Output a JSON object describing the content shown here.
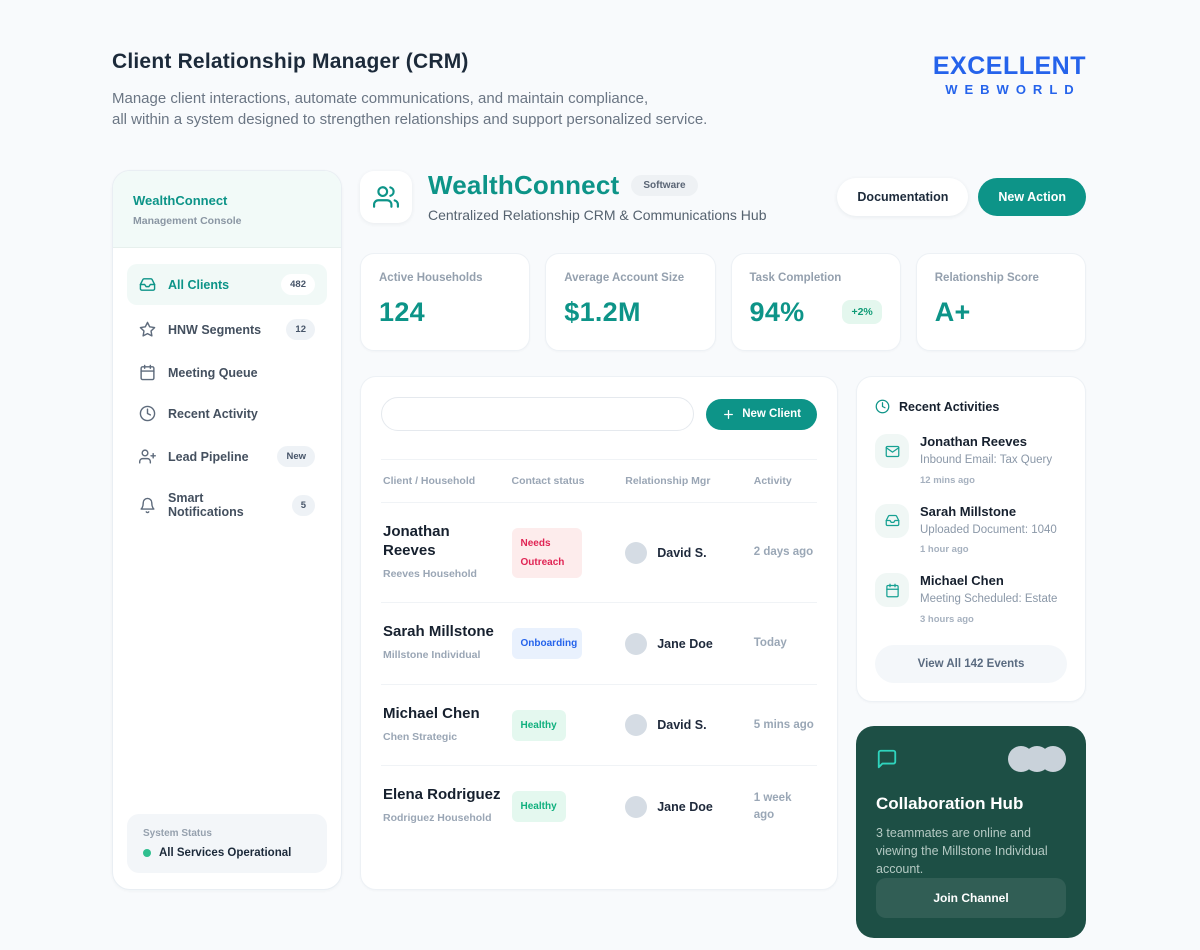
{
  "page": {
    "title": "Client Relationship Manager (CRM)",
    "subtitle_line1": "Manage client interactions, automate communications, and maintain compliance,",
    "subtitle_line2": "all within a system designed to strengthen relationships and support personalized service.",
    "logo_line1": "EXCELLENT",
    "logo_line2": "WEBWORLD"
  },
  "sidebar": {
    "brand": "WealthConnect",
    "brand_sub": "Management Console",
    "items": [
      {
        "label": "All Clients",
        "badge": "482",
        "icon": "inbox-icon"
      },
      {
        "label": "HNW Segments",
        "badge": "12",
        "icon": "star-icon"
      },
      {
        "label": "Meeting Queue",
        "badge": "",
        "icon": "calendar-icon"
      },
      {
        "label": "Recent Activity",
        "badge": "",
        "icon": "clock-icon"
      },
      {
        "label": "Lead Pipeline",
        "badge": "New",
        "icon": "user-plus-icon"
      },
      {
        "label": "Smart Notifications",
        "badge": "5",
        "icon": "bell-icon"
      }
    ],
    "system_status_label": "System Status",
    "system_status_value": "All Services Operational"
  },
  "header": {
    "app_name": "WealthConnect",
    "app_badge": "Software",
    "subtitle": "Centralized Relationship CRM & Communications Hub",
    "documentation_label": "Documentation",
    "new_action_label": "New Action"
  },
  "stats": [
    {
      "label": "Active Households",
      "value": "124",
      "delta": ""
    },
    {
      "label": "Average Account Size",
      "value": "$1.2M",
      "delta": ""
    },
    {
      "label": "Task Completion",
      "value": "94%",
      "delta": "+2%"
    },
    {
      "label": "Relationship Score",
      "value": "A+",
      "delta": ""
    }
  ],
  "clients": {
    "search_placeholder": "",
    "new_client_label": "New Client",
    "columns": {
      "c0": "Client / Household",
      "c1": "Contact status",
      "c2": "Relationship Mgr",
      "c3": "Activity"
    },
    "rows": [
      {
        "name": "Jonathan Reeves",
        "household": "Reeves Household",
        "status": "Needs Outreach",
        "status_type": "danger",
        "manager": "David S.",
        "activity": "2 days ago"
      },
      {
        "name": "Sarah Millstone",
        "household": "Millstone Individual",
        "status": "Onboarding",
        "status_type": "info",
        "manager": "Jane Doe",
        "activity": "Today"
      },
      {
        "name": "Michael Chen",
        "household": "Chen Strategic",
        "status": "Healthy",
        "status_type": "success",
        "manager": "David S.",
        "activity": "5 mins ago"
      },
      {
        "name": "Elena Rodriguez",
        "household": "Rodriguez Household",
        "status": "Healthy",
        "status_type": "success",
        "manager": "Jane Doe",
        "activity": "1 week ago"
      }
    ]
  },
  "activities": {
    "title": "Recent Activities",
    "items": [
      {
        "name": "Jonathan Reeves",
        "detail": "Inbound Email: Tax Query",
        "time": "12 mins ago",
        "icon": "mail-icon"
      },
      {
        "name": "Sarah Millstone",
        "detail": "Uploaded Document: 1040",
        "time": "1 hour ago",
        "icon": "inbox-icon"
      },
      {
        "name": "Michael Chen",
        "detail": "Meeting Scheduled: Estate",
        "time": "3 hours ago",
        "icon": "calendar-icon"
      }
    ],
    "view_all_label": "View All 142 Events"
  },
  "collaboration": {
    "title": "Collaboration Hub",
    "description": "3 teammates are online and viewing the Millstone Individual account.",
    "join_label": "Join Channel"
  },
  "colors": {
    "accent_teal": "#0d9488",
    "logo_blue": "#2563eb",
    "danger": "#e02454",
    "info": "#2563eb",
    "success": "#10b07e",
    "dark_card": "#1d4f45",
    "status_dot_green": "#2fbf8f"
  }
}
